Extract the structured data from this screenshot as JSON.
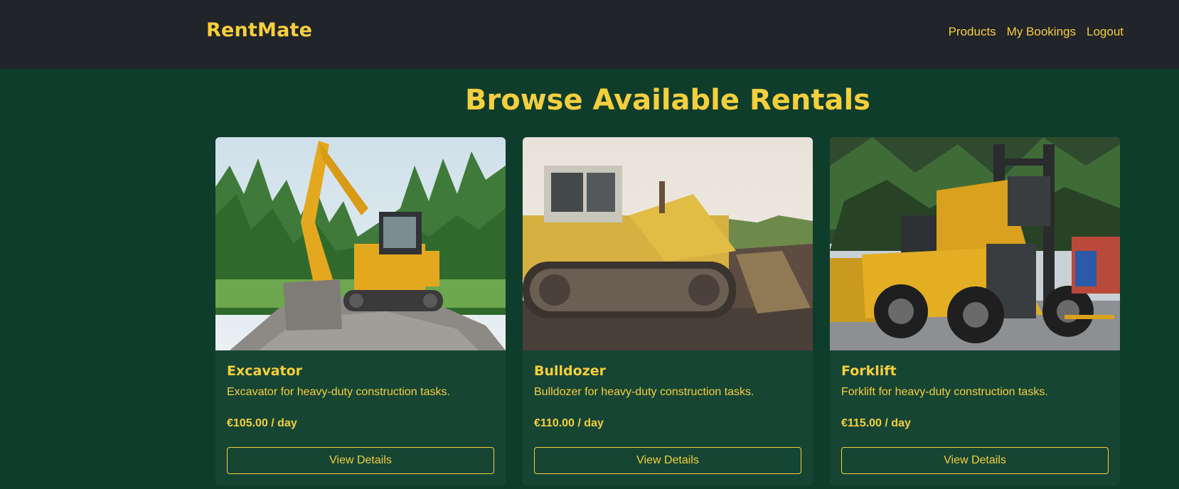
{
  "navbar": {
    "brand": "RentMate",
    "links": [
      "Products",
      "My Bookings",
      "Logout"
    ]
  },
  "page": {
    "title": "Browse Available Rentals"
  },
  "products": [
    {
      "name": "Excavator",
      "description": "Excavator for heavy-duty construction tasks.",
      "price": "€105.00 / day",
      "button": "View Details",
      "image_icon": "excavator-photo"
    },
    {
      "name": "Bulldozer",
      "description": "Bulldozer for heavy-duty construction tasks.",
      "price": "€110.00 / day",
      "button": "View Details",
      "image_icon": "bulldozer-photo"
    },
    {
      "name": "Forklift",
      "description": "Forklift for heavy-duty construction tasks.",
      "price": "€115.00 / day",
      "button": "View Details",
      "image_icon": "forklift-photo"
    }
  ],
  "colors": {
    "navbar_bg": "#212429",
    "page_bg": "#0f3d2c",
    "card_bg": "#164534",
    "accent": "#f5cf3d"
  }
}
